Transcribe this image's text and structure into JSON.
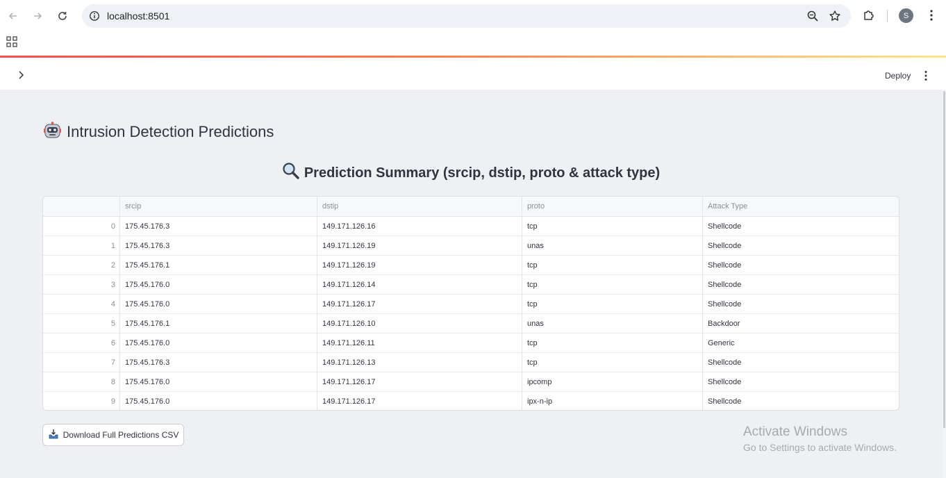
{
  "browser": {
    "url": "localhost:8501",
    "profile_initial": "S"
  },
  "app_header": {
    "deploy_label": "Deploy"
  },
  "main": {
    "title": "Intrusion Detection Predictions",
    "subtitle": "Prediction Summary (srcip, dstip, proto & attack type)",
    "download_label": "Download Full Predictions CSV"
  },
  "table": {
    "columns": [
      "srcip",
      "dstip",
      "proto",
      "Attack Type"
    ],
    "rows": [
      {
        "index": "0",
        "srcip": "175.45.176.3",
        "dstip": "149.171.126.16",
        "proto": "tcp",
        "attack": "Shellcode"
      },
      {
        "index": "1",
        "srcip": "175.45.176.3",
        "dstip": "149.171.126.19",
        "proto": "unas",
        "attack": "Shellcode"
      },
      {
        "index": "2",
        "srcip": "175.45.176.1",
        "dstip": "149.171.126.19",
        "proto": "tcp",
        "attack": "Shellcode"
      },
      {
        "index": "3",
        "srcip": "175.45.176.0",
        "dstip": "149.171.126.14",
        "proto": "tcp",
        "attack": "Shellcode"
      },
      {
        "index": "4",
        "srcip": "175.45.176.0",
        "dstip": "149.171.126.17",
        "proto": "tcp",
        "attack": "Shellcode"
      },
      {
        "index": "5",
        "srcip": "175.45.176.1",
        "dstip": "149.171.126.10",
        "proto": "unas",
        "attack": "Backdoor"
      },
      {
        "index": "6",
        "srcip": "175.45.176.0",
        "dstip": "149.171.126.11",
        "proto": "tcp",
        "attack": "Generic"
      },
      {
        "index": "7",
        "srcip": "175.45.176.3",
        "dstip": "149.171.126.13",
        "proto": "tcp",
        "attack": "Shellcode"
      },
      {
        "index": "8",
        "srcip": "175.45.176.0",
        "dstip": "149.171.126.17",
        "proto": "ipcomp",
        "attack": "Shellcode"
      },
      {
        "index": "9",
        "srcip": "175.45.176.0",
        "dstip": "149.171.126.17",
        "proto": "ipx-n-ip",
        "attack": "Shellcode"
      }
    ]
  },
  "watermark": {
    "title": "Activate Windows",
    "subtitle": "Go to Settings to activate Windows."
  },
  "icons": {
    "back": "back-arrow-icon",
    "forward": "forward-arrow-icon",
    "reload": "reload-icon",
    "info": "info-icon",
    "zoom": "zoom-icon",
    "bookmark": "star-icon",
    "extensions": "puzzle-icon",
    "menu": "kebab-menu-icon",
    "apps": "apps-grid-icon",
    "sidebar": "chevron-right-icon",
    "title_emoji": "robot-face-icon",
    "subtitle_emoji": "magnifier-icon",
    "download": "inbox-tray-icon"
  },
  "colors": {
    "accent_start": "#ff4b4b",
    "accent_end": "#fde68a",
    "page_bg": "#eef0f4"
  }
}
